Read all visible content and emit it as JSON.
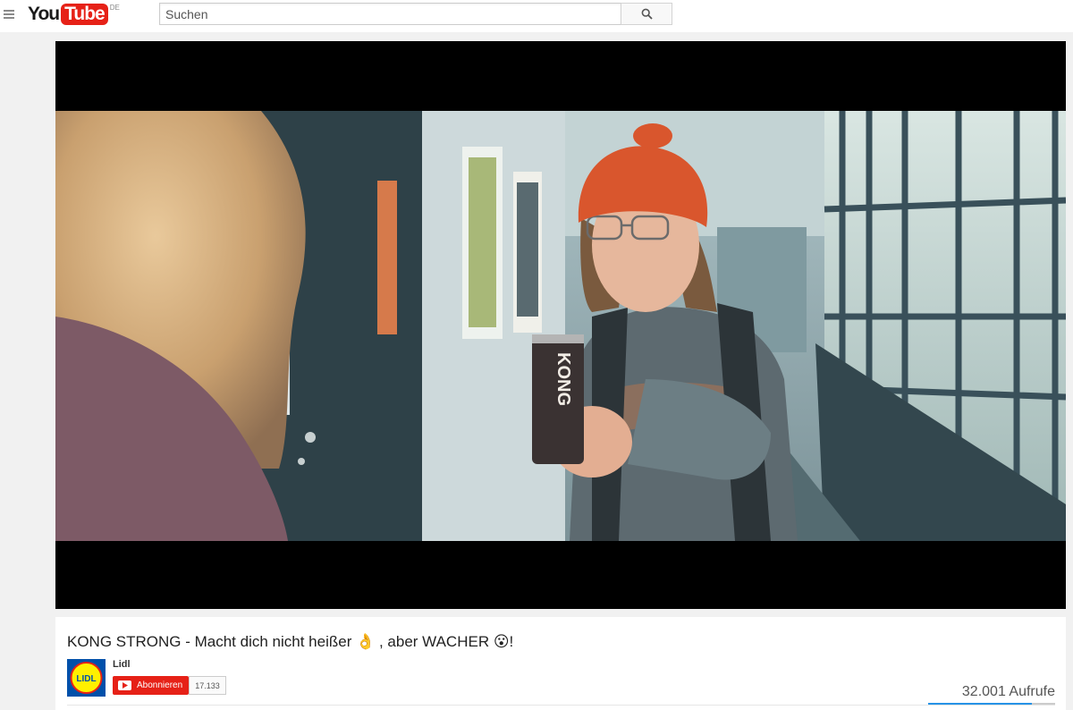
{
  "masthead": {
    "logo_you": "You",
    "logo_tube": "Tube",
    "logo_region": "DE",
    "search_placeholder": "Suchen"
  },
  "video": {
    "title": "KONG STRONG - Macht dich nicht heißer 👌 , aber WACHER 😮!",
    "can_text": "KONG"
  },
  "channel": {
    "name": "Lidl",
    "logo_text": "LIDL",
    "subscribe_label": "Abonnieren",
    "subscriber_count": "17.133"
  },
  "stats": {
    "views": "32.001 Aufrufe",
    "like_ratio": 0.82
  },
  "colors": {
    "brand_red": "#e62117",
    "lidl_blue": "#0050aa",
    "lidl_yellow": "#fff000",
    "like_bar": "#2793e6"
  }
}
